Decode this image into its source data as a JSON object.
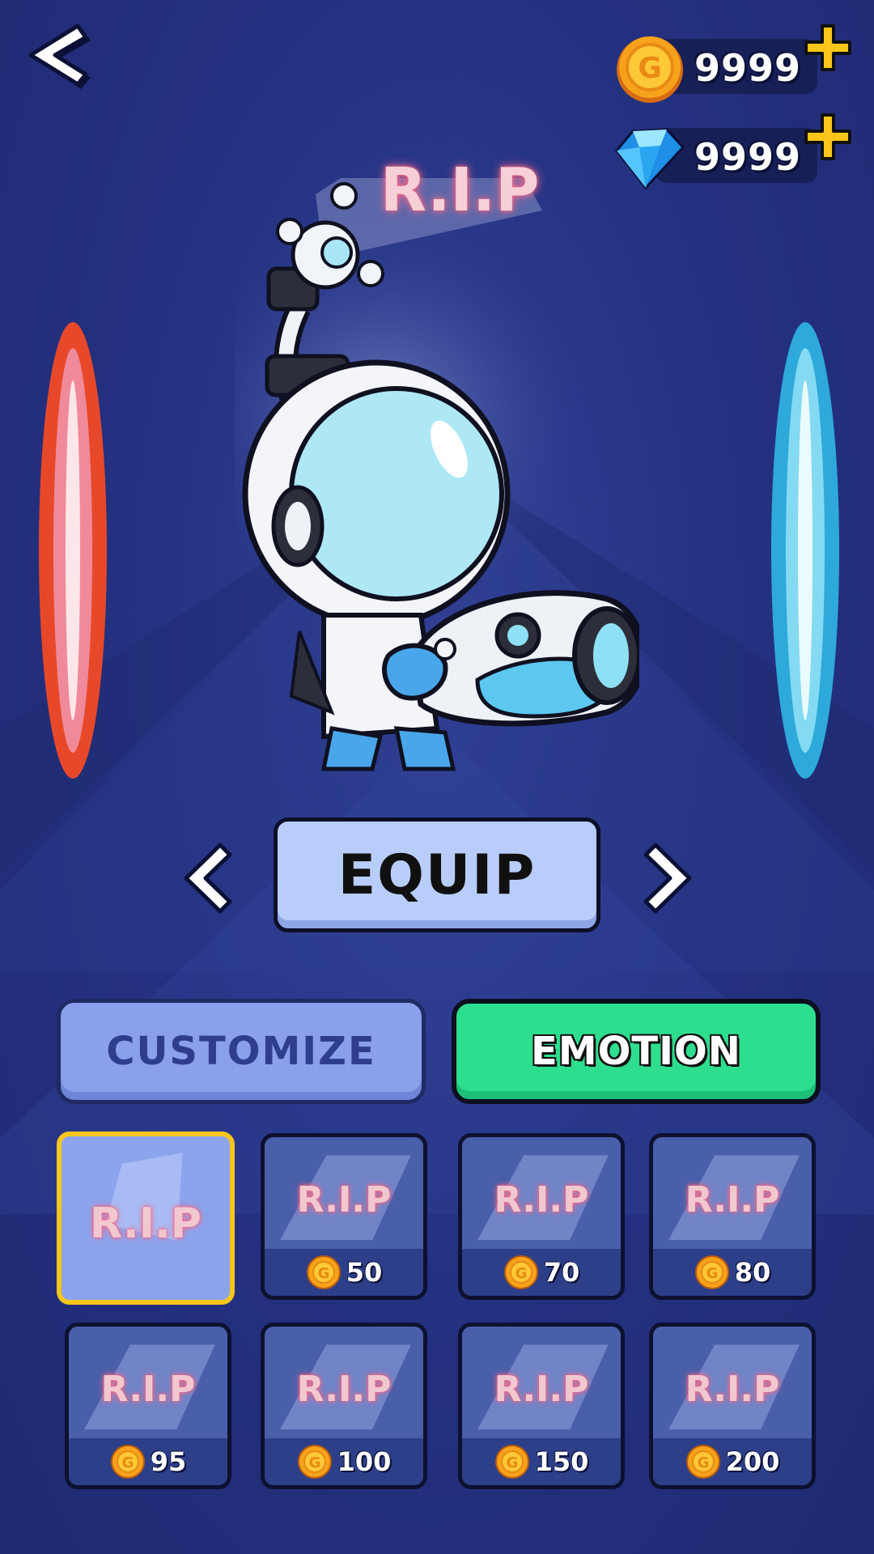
{
  "header": {
    "coins": {
      "value": "9999",
      "icon": "gold-coin-icon"
    },
    "gems": {
      "value": "9999",
      "icon": "blue-diamond-icon"
    }
  },
  "preview": {
    "emotion_label": "R.I.P",
    "character": "astronaut-with-blaster",
    "left_portal_color": "#e8482a",
    "right_portal_color": "#2ea9dc"
  },
  "actions": {
    "equip_label": "EQUIP"
  },
  "tabs": {
    "customize": "CUSTOMIZE",
    "emotion": "EMOTION",
    "active": "emotion"
  },
  "items": [
    {
      "label": "R.I.P",
      "price": null,
      "selected": true
    },
    {
      "label": "R.I.P",
      "price": "50"
    },
    {
      "label": "R.I.P",
      "price": "70"
    },
    {
      "label": "R.I.P",
      "price": "80"
    },
    {
      "label": "R.I.P",
      "price": "95"
    },
    {
      "label": "R.I.P",
      "price": "100"
    },
    {
      "label": "R.I.P",
      "price": "150"
    },
    {
      "label": "R.I.P",
      "price": "200"
    }
  ],
  "colors": {
    "background": "#253282",
    "accent_green": "#2ede8f",
    "selected_border": "#f7c61c",
    "equip_button": "#b9cdfb"
  }
}
